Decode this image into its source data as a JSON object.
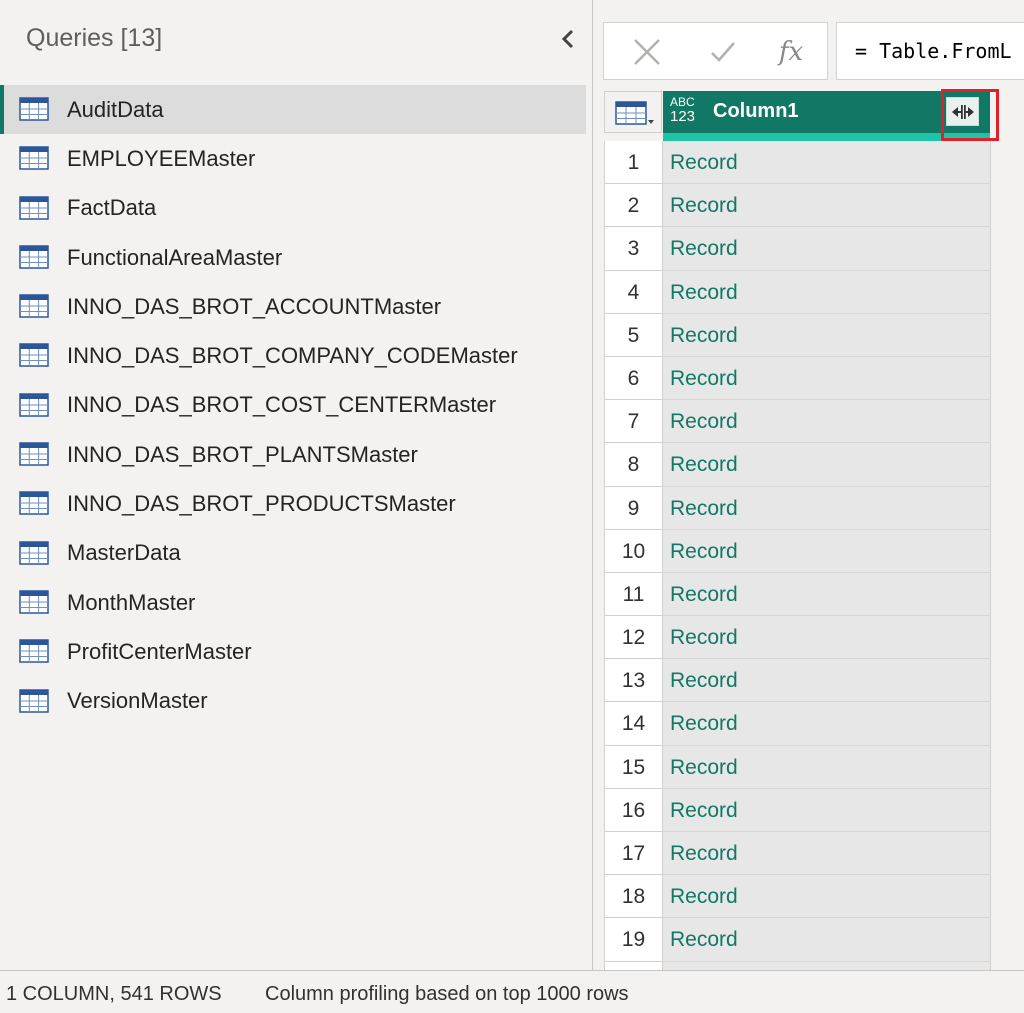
{
  "queries": {
    "header": "Queries [13]",
    "items": [
      {
        "label": "AuditData",
        "selected": true
      },
      {
        "label": "EMPLOYEEMaster"
      },
      {
        "label": "FactData"
      },
      {
        "label": "FunctionalAreaMaster"
      },
      {
        "label": "INNO_DAS_BROT_ACCOUNTMaster"
      },
      {
        "label": "INNO_DAS_BROT_COMPANY_CODEMaster"
      },
      {
        "label": "INNO_DAS_BROT_COST_CENTERMaster"
      },
      {
        "label": "INNO_DAS_BROT_PLANTSMaster"
      },
      {
        "label": "INNO_DAS_BROT_PRODUCTSMaster"
      },
      {
        "label": "MasterData"
      },
      {
        "label": "MonthMaster"
      },
      {
        "label": "ProfitCenterMaster"
      },
      {
        "label": "VersionMaster"
      }
    ]
  },
  "formula_bar": {
    "fx_label": "fx",
    "formula": "= Table.FromL"
  },
  "grid": {
    "type_icon_top": "ABC",
    "type_icon_bottom": "123",
    "column_header": "Column1",
    "rows": [
      {
        "num": "1",
        "value": "Record"
      },
      {
        "num": "2",
        "value": "Record"
      },
      {
        "num": "3",
        "value": "Record"
      },
      {
        "num": "4",
        "value": "Record"
      },
      {
        "num": "5",
        "value": "Record"
      },
      {
        "num": "6",
        "value": "Record"
      },
      {
        "num": "7",
        "value": "Record"
      },
      {
        "num": "8",
        "value": "Record"
      },
      {
        "num": "9",
        "value": "Record"
      },
      {
        "num": "10",
        "value": "Record"
      },
      {
        "num": "11",
        "value": "Record"
      },
      {
        "num": "12",
        "value": "Record"
      },
      {
        "num": "13",
        "value": "Record"
      },
      {
        "num": "14",
        "value": "Record"
      },
      {
        "num": "15",
        "value": "Record"
      },
      {
        "num": "16",
        "value": "Record"
      },
      {
        "num": "17",
        "value": "Record"
      },
      {
        "num": "18",
        "value": "Record"
      },
      {
        "num": "19",
        "value": "Record"
      }
    ]
  },
  "status": {
    "summary": "1 COLUMN, 541 ROWS",
    "profiling": "Column profiling based on top 1000 rows"
  },
  "colors": {
    "accent": "#117865",
    "accent_light": "#1ec3a8",
    "highlight": "#e0202a"
  },
  "icons": [
    "collapse-chevron-icon",
    "table-icon",
    "cancel-x-icon",
    "commit-check-icon",
    "fx-icon",
    "column-table-icon",
    "any-type-icon",
    "expand-record-icon"
  ]
}
